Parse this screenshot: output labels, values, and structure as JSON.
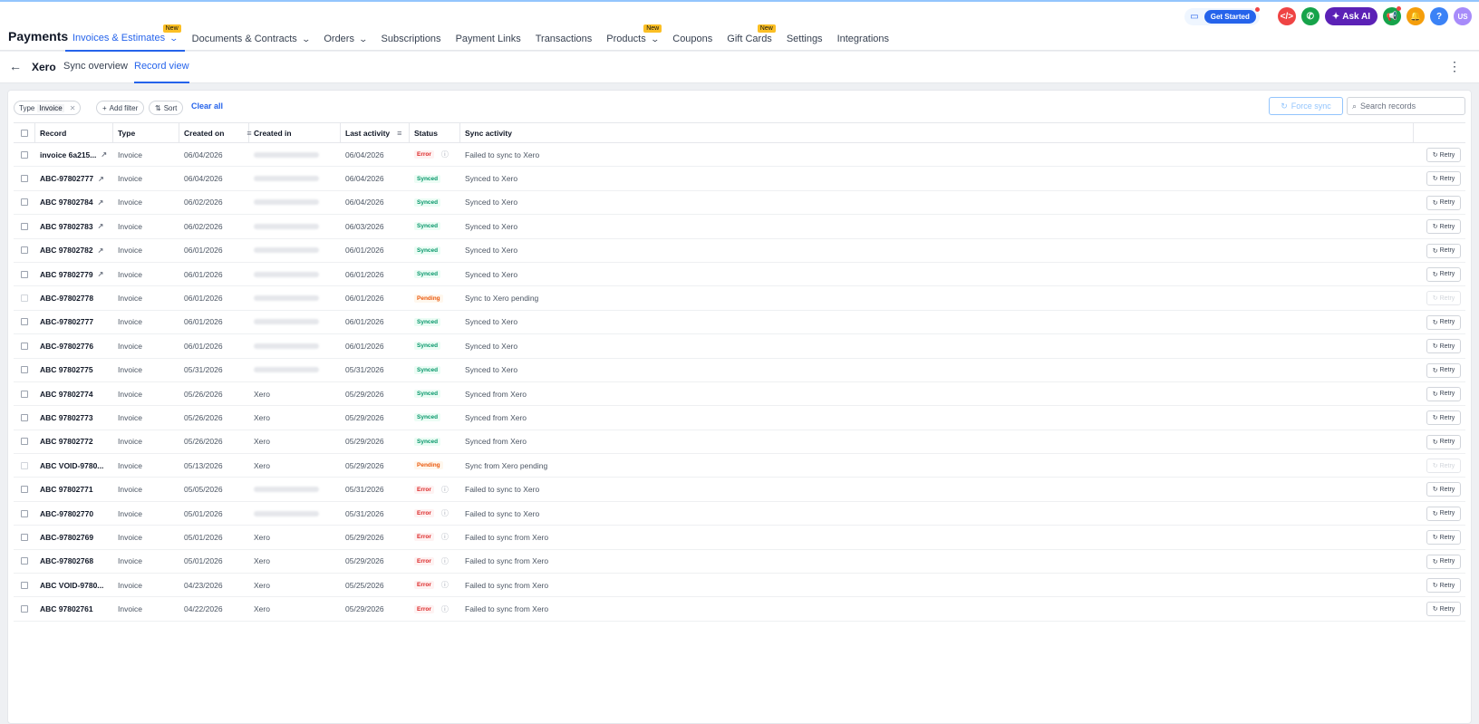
{
  "header": {
    "app_title": "Payments",
    "nav": [
      {
        "label": "Invoices & Estimates",
        "active": true,
        "dropdown": true,
        "new": true
      },
      {
        "label": "Documents & Contracts",
        "dropdown": true
      },
      {
        "label": "Orders",
        "dropdown": true
      },
      {
        "label": "Subscriptions"
      },
      {
        "label": "Payment Links"
      },
      {
        "label": "Transactions"
      },
      {
        "label": "Products",
        "dropdown": true,
        "new": true
      },
      {
        "label": "Coupons"
      },
      {
        "label": "Gift Cards",
        "new": true
      },
      {
        "label": "Settings"
      },
      {
        "label": "Integrations"
      }
    ],
    "new_badge": "New",
    "get_started": "Get Started",
    "ask_ai": "Ask AI",
    "user_initials": "US",
    "help": "?"
  },
  "subheader": {
    "title": "Xero",
    "tabs": [
      {
        "label": "Sync overview"
      },
      {
        "label": "Record view",
        "active": true
      }
    ]
  },
  "toolbar": {
    "filter_key": "Type",
    "filter_value": "Invoice",
    "add_filter": "Add filter",
    "sort": "Sort",
    "clear_all": "Clear all",
    "force_sync": "Force sync",
    "search_placeholder": "Search records"
  },
  "table": {
    "columns": [
      "Record",
      "Type",
      "Created on",
      "Created in",
      "Last activity",
      "Status",
      "Sync activity"
    ],
    "retry_label": "Retry",
    "rows": [
      {
        "record": "invoice 6a215...",
        "ext": true,
        "type": "Invoice",
        "created_on": "06/04/2026",
        "created_in": "",
        "last_activity": "06/04/2026",
        "status": "Error",
        "activity": "Failed to sync to Xero"
      },
      {
        "record": "ABC-97802777",
        "ext": true,
        "type": "Invoice",
        "created_on": "06/04/2026",
        "created_in": "",
        "last_activity": "06/04/2026",
        "status": "Synced",
        "activity": "Synced to Xero"
      },
      {
        "record": "ABC 97802784",
        "ext": true,
        "type": "Invoice",
        "created_on": "06/02/2026",
        "created_in": "",
        "last_activity": "06/04/2026",
        "status": "Synced",
        "activity": "Synced to Xero"
      },
      {
        "record": "ABC 97802783",
        "ext": true,
        "type": "Invoice",
        "created_on": "06/02/2026",
        "created_in": "",
        "last_activity": "06/03/2026",
        "status": "Synced",
        "activity": "Synced to Xero"
      },
      {
        "record": "ABC 97802782",
        "ext": true,
        "type": "Invoice",
        "created_on": "06/01/2026",
        "created_in": "",
        "last_activity": "06/01/2026",
        "status": "Synced",
        "activity": "Synced to Xero"
      },
      {
        "record": "ABC 97802779",
        "ext": true,
        "type": "Invoice",
        "created_on": "06/01/2026",
        "created_in": "",
        "last_activity": "06/01/2026",
        "status": "Synced",
        "activity": "Synced to Xero"
      },
      {
        "record": "ABC-97802778",
        "ext": false,
        "type": "Invoice",
        "created_on": "06/01/2026",
        "created_in": "",
        "last_activity": "06/01/2026",
        "status": "Pending",
        "activity": "Sync to Xero pending"
      },
      {
        "record": "ABC-97802777",
        "ext": false,
        "type": "Invoice",
        "created_on": "06/01/2026",
        "created_in": "",
        "last_activity": "06/01/2026",
        "status": "Synced",
        "activity": "Synced to Xero"
      },
      {
        "record": "ABC-97802776",
        "ext": false,
        "type": "Invoice",
        "created_on": "06/01/2026",
        "created_in": "",
        "last_activity": "06/01/2026",
        "status": "Synced",
        "activity": "Synced to Xero"
      },
      {
        "record": "ABC 97802775",
        "ext": false,
        "type": "Invoice",
        "created_on": "05/31/2026",
        "created_in": "",
        "last_activity": "05/31/2026",
        "status": "Synced",
        "activity": "Synced to Xero"
      },
      {
        "record": "ABC 97802774",
        "ext": false,
        "type": "Invoice",
        "created_on": "05/26/2026",
        "created_in": "Xero",
        "last_activity": "05/29/2026",
        "status": "Synced",
        "activity": "Synced from Xero"
      },
      {
        "record": "ABC 97802773",
        "ext": false,
        "type": "Invoice",
        "created_on": "05/26/2026",
        "created_in": "Xero",
        "last_activity": "05/29/2026",
        "status": "Synced",
        "activity": "Synced from Xero"
      },
      {
        "record": "ABC 97802772",
        "ext": false,
        "type": "Invoice",
        "created_on": "05/26/2026",
        "created_in": "Xero",
        "last_activity": "05/29/2026",
        "status": "Synced",
        "activity": "Synced from Xero"
      },
      {
        "record": "ABC VOID-9780...",
        "ext": false,
        "type": "Invoice",
        "created_on": "05/13/2026",
        "created_in": "Xero",
        "last_activity": "05/29/2026",
        "status": "Pending",
        "activity": "Sync from Xero pending"
      },
      {
        "record": "ABC 97802771",
        "ext": false,
        "type": "Invoice",
        "created_on": "05/05/2026",
        "created_in": "",
        "last_activity": "05/31/2026",
        "status": "Error",
        "activity": "Failed to sync to Xero"
      },
      {
        "record": "ABC-97802770",
        "ext": false,
        "type": "Invoice",
        "created_on": "05/01/2026",
        "created_in": "",
        "last_activity": "05/31/2026",
        "status": "Error",
        "activity": "Failed to sync to Xero"
      },
      {
        "record": "ABC-97802769",
        "ext": false,
        "type": "Invoice",
        "created_on": "05/01/2026",
        "created_in": "Xero",
        "last_activity": "05/29/2026",
        "status": "Error",
        "activity": "Failed to sync from Xero"
      },
      {
        "record": "ABC-97802768",
        "ext": false,
        "type": "Invoice",
        "created_on": "05/01/2026",
        "created_in": "Xero",
        "last_activity": "05/29/2026",
        "status": "Error",
        "activity": "Failed to sync from Xero"
      },
      {
        "record": "ABC VOID-9780...",
        "ext": false,
        "type": "Invoice",
        "created_on": "04/23/2026",
        "created_in": "Xero",
        "last_activity": "05/25/2026",
        "status": "Error",
        "activity": "Failed to sync from Xero"
      },
      {
        "record": "ABC 97802761",
        "ext": false,
        "type": "Invoice",
        "created_on": "04/22/2026",
        "created_in": "Xero",
        "last_activity": "05/29/2026",
        "status": "Error",
        "activity": "Failed to sync from Xero"
      }
    ]
  },
  "colors": {
    "accent": "#2563eb",
    "error": "#dc2626",
    "synced": "#059669",
    "pending": "#ea580c"
  }
}
